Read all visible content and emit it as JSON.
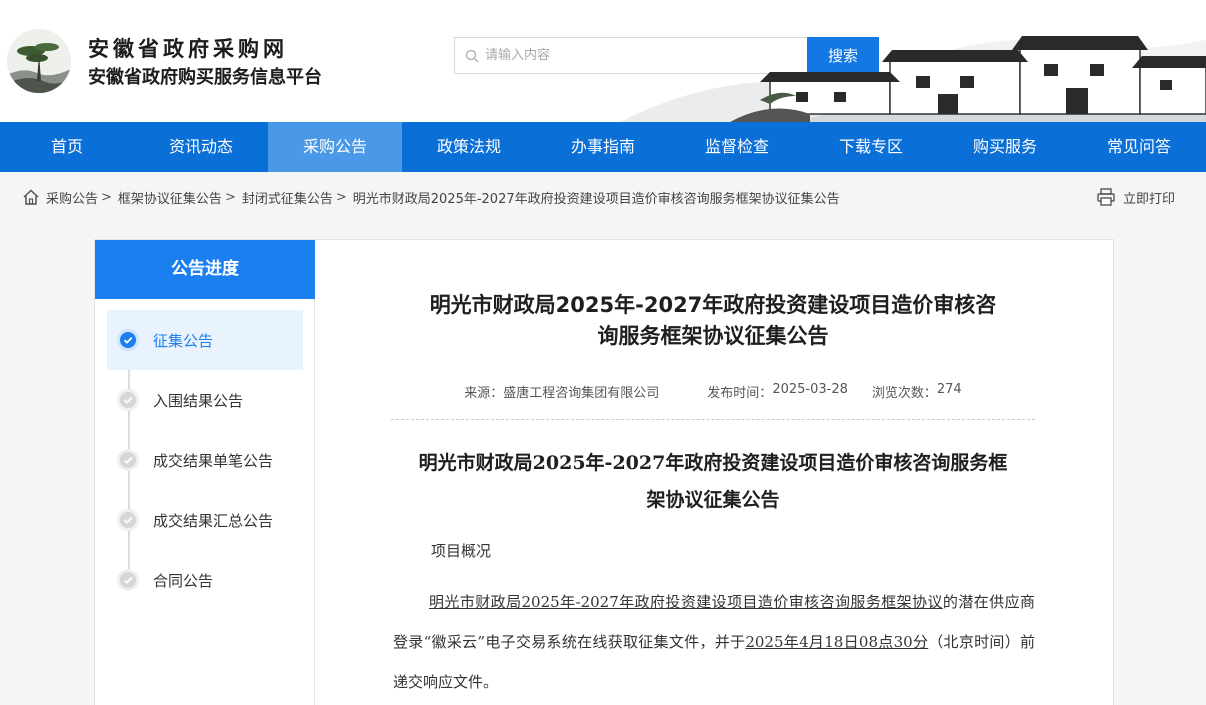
{
  "header": {
    "site_title": "安徽省政府采购网",
    "site_subtitle": "安徽省政府购买服务信息平台",
    "search_placeholder": "请输入内容",
    "search_button": "搜索"
  },
  "nav": {
    "items": [
      {
        "label": "首页"
      },
      {
        "label": "资讯动态"
      },
      {
        "label": "采购公告"
      },
      {
        "label": "政策法规"
      },
      {
        "label": "办事指南"
      },
      {
        "label": "监督检查"
      },
      {
        "label": "下载专区"
      },
      {
        "label": "购买服务"
      },
      {
        "label": "常见问答"
      }
    ],
    "active_index": 2
  },
  "breadcrumb": {
    "items": [
      "采购公告",
      "框架协议征集公告",
      "封闭式征集公告",
      "明光市财政局2025年-2027年政府投资建设项目造价审核咨询服务框架协议征集公告"
    ],
    "separator": ">",
    "print_label": "立即打印"
  },
  "sidebar": {
    "title": "公告进度",
    "steps": [
      {
        "label": "征集公告",
        "active": true
      },
      {
        "label": "入围结果公告",
        "active": false
      },
      {
        "label": "成交结果单笔公告",
        "active": false
      },
      {
        "label": "成交结果汇总公告",
        "active": false
      },
      {
        "label": "合同公告",
        "active": false
      }
    ]
  },
  "article": {
    "title_line1": "明光市财政局2025年-2027年政府投资建设项目造价审核咨",
    "title_line2": "询服务框架协议征集公告",
    "source_label": "来源：",
    "source": "盛唐工程咨询集团有限公司",
    "date_label": "发布时间：",
    "date": "2025-03-28",
    "views_label": "浏览次数：",
    "views": "274",
    "body_title_line1": "明光市财政局2025年-2027年政府投资建设项目造价审核咨询服务框",
    "body_title_line2": "架协议征集公告",
    "section": "项目概况",
    "para_part1": "明光市财政局2025年-2027年政府投资建设项目造价审核咨询服务框架协议",
    "para_part2": "的潜在供应商登录“徽采云”电子交易系统在线获取征集文件，并于",
    "para_part3": "2025年4月18日08点30分",
    "para_part4": "（北京时间）前递交响应文件。"
  }
}
